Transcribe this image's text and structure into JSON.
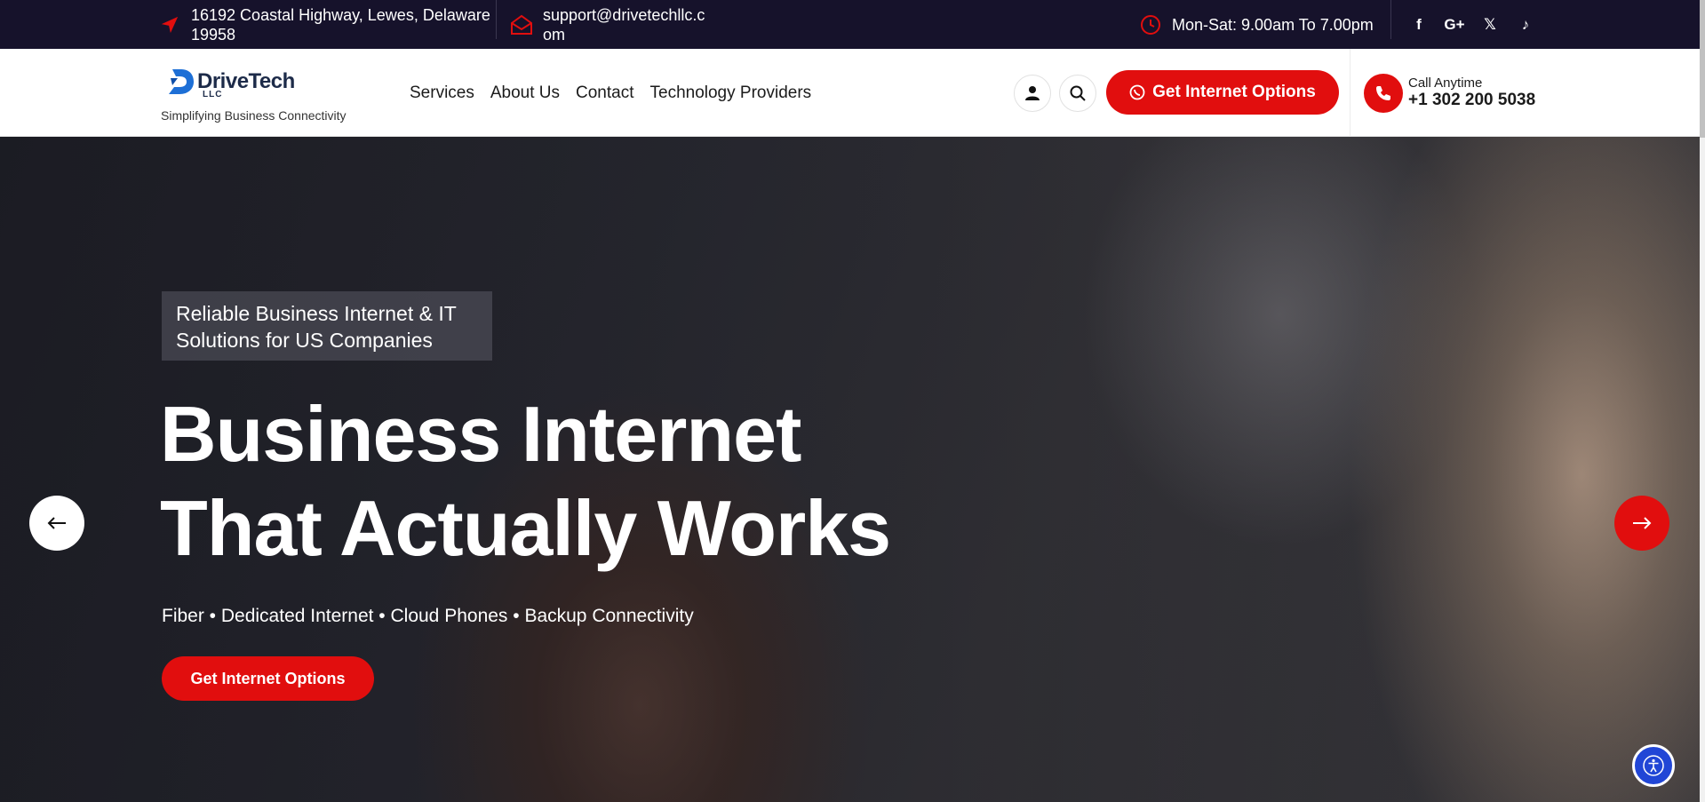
{
  "topbar": {
    "address": "16192 Coastal Highway, Lewes, Delaware 19958",
    "email": "support@drivetechllc.com",
    "hours": "Mon-Sat: 9.00am To 7.00pm",
    "social": [
      {
        "name": "facebook-icon",
        "glyph": "f"
      },
      {
        "name": "google-plus-icon",
        "glyph": "G+"
      },
      {
        "name": "x-icon",
        "glyph": "𝕏"
      },
      {
        "name": "tiktok-icon",
        "glyph": "♪"
      }
    ]
  },
  "header": {
    "logo_name": "DriveTech",
    "logo_suffix": "LLC",
    "tagline": "Simplifying Business Connectivity",
    "nav": [
      "Services",
      "About Us",
      "Contact",
      "Technology Providers"
    ],
    "cta_label": "Get Internet Options",
    "call_label": "Call Anytime",
    "call_number": "+1 302 200 5038"
  },
  "hero": {
    "eyebrow": "Reliable Business Internet & IT Solutions for US Companies",
    "headline": "Business Internet That Actually Works",
    "subline": "Fiber • Dedicated Internet • Cloud Phones • Backup Connectivity",
    "button_label": "Get Internet Options"
  },
  "colors": {
    "accent": "#e10e0e",
    "topbar_bg": "#16122b",
    "brand_navy": "#1d2b49",
    "accessibility_blue": "#2146d6"
  }
}
